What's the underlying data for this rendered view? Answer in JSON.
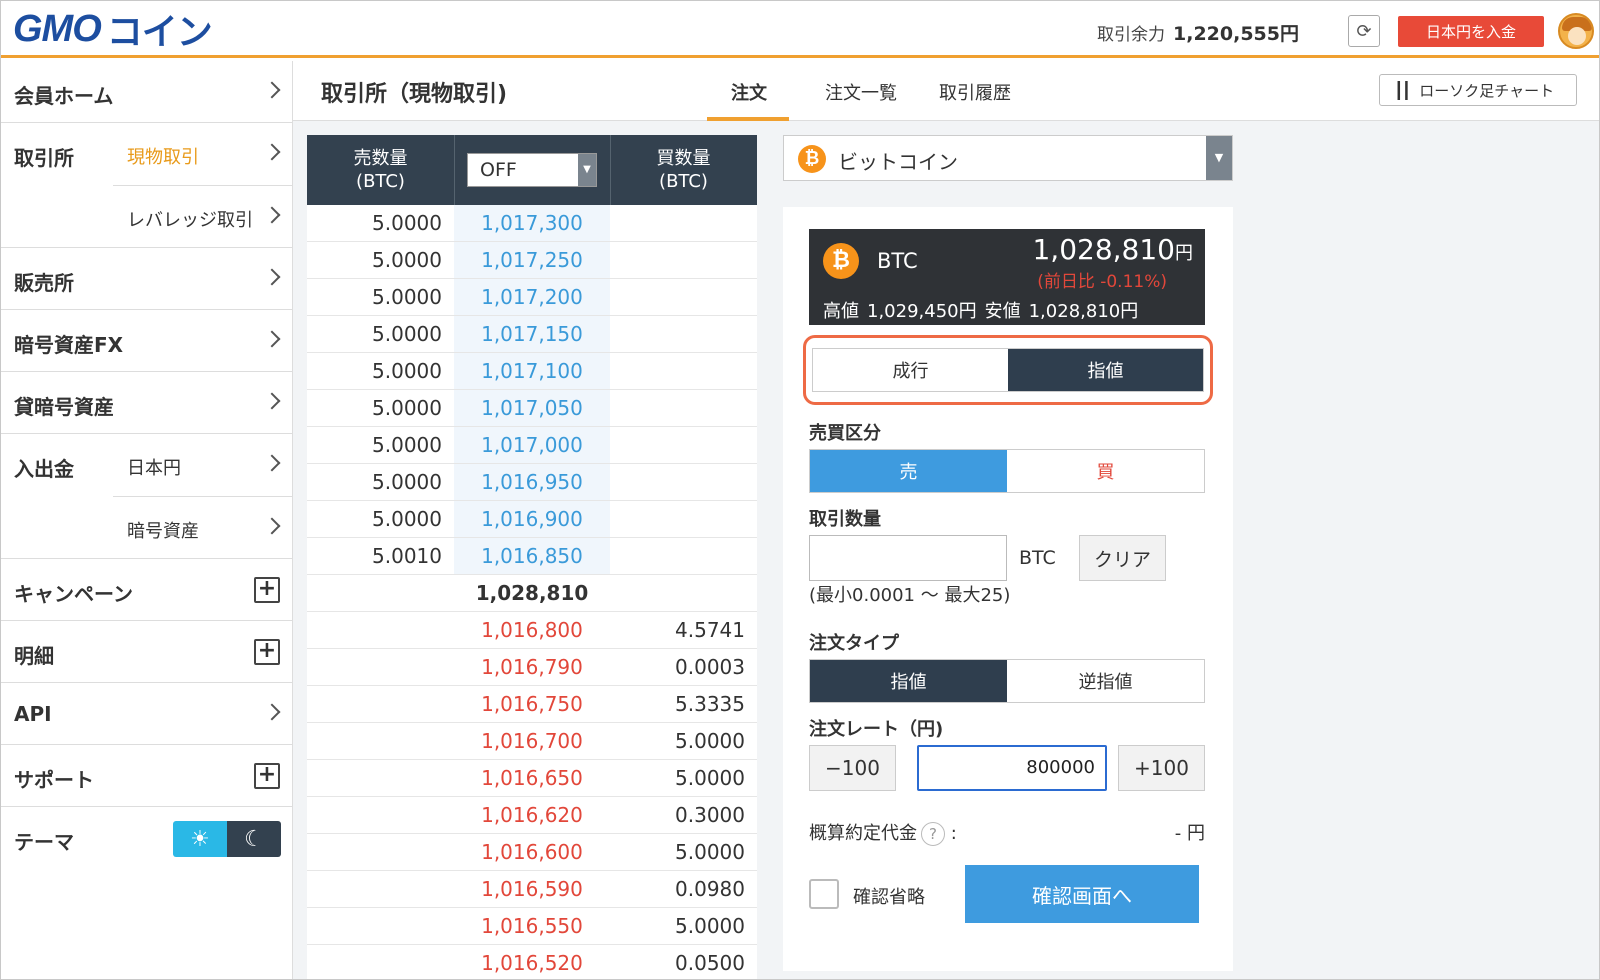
{
  "header": {
    "logo_text": "GMO",
    "logo_sub": "コイン",
    "balance_label": "取引余力",
    "balance_value": "1,220,555円",
    "refresh_icon": "refresh-icon",
    "deposit_button": "日本円を入金",
    "accent_color": "#f0a030",
    "brand_color": "#1d4ea0"
  },
  "sidebar": {
    "home": "会員ホーム",
    "exchange": "取引所",
    "exchange_spot": "現物取引",
    "exchange_leverage": "レバレッジ取引",
    "sales": "販売所",
    "fx": "暗号資産FX",
    "lending": "貸暗号資産",
    "deposit": "入出金",
    "deposit_jpy": "日本円",
    "deposit_crypto": "暗号資産",
    "campaign": "キャンペーン",
    "statement": "明細",
    "api": "API",
    "support": "サポート",
    "theme": "テーマ",
    "active_color": "#e89a1a"
  },
  "topbar": {
    "title": "取引所（現物取引)",
    "tabs": [
      "注文",
      "注文一覧",
      "取引履歴"
    ],
    "chart_button": "ローソク足チャート"
  },
  "orderbook": {
    "sell_header": "売数量",
    "sell_unit": "(BTC)",
    "buy_header": "買数量",
    "buy_unit": "(BTC)",
    "group_select": "OFF",
    "asks": [
      {
        "qty": "5.0000",
        "price": "1,017,300"
      },
      {
        "qty": "5.0000",
        "price": "1,017,250"
      },
      {
        "qty": "5.0000",
        "price": "1,017,200"
      },
      {
        "qty": "5.0000",
        "price": "1,017,150"
      },
      {
        "qty": "5.0000",
        "price": "1,017,100"
      },
      {
        "qty": "5.0000",
        "price": "1,017,050"
      },
      {
        "qty": "5.0000",
        "price": "1,017,000"
      },
      {
        "qty": "5.0000",
        "price": "1,016,950"
      },
      {
        "qty": "5.0000",
        "price": "1,016,900"
      },
      {
        "qty": "5.0010",
        "price": "1,016,850"
      }
    ],
    "last_price": "1,028,810",
    "bids": [
      {
        "price": "1,016,800",
        "qty": "4.5741"
      },
      {
        "price": "1,016,790",
        "qty": "0.0003"
      },
      {
        "price": "1,016,750",
        "qty": "5.3335"
      },
      {
        "price": "1,016,700",
        "qty": "5.0000"
      },
      {
        "price": "1,016,650",
        "qty": "5.0000"
      },
      {
        "price": "1,016,620",
        "qty": "0.3000"
      },
      {
        "price": "1,016,600",
        "qty": "5.0000"
      },
      {
        "price": "1,016,590",
        "qty": "0.0980"
      },
      {
        "price": "1,016,550",
        "qty": "5.0000"
      },
      {
        "price": "1,016,520",
        "qty": "0.0500"
      }
    ],
    "ask_color": "#3a9ad9",
    "bid_color": "#e2473a"
  },
  "coin_select": {
    "icon": "bitcoin-icon",
    "name": "ビットコイン"
  },
  "ticker": {
    "symbol": "BTC",
    "price": "1,028,810",
    "yen": "円",
    "change": "(前日比 -0.11%)",
    "high_label": "高値",
    "high_value": "1,029,450円",
    "low_label": "安値",
    "low_value": "1,028,810円"
  },
  "order_form": {
    "market": "成行",
    "limit": "指値",
    "side_label": "売買区分",
    "sell": "売",
    "buy": "買",
    "qty_label": "取引数量",
    "qty_value": "",
    "qty_unit": "BTC",
    "clear": "クリア",
    "qty_range": "(最小0.0001 〜 最大25)",
    "type_label": "注文タイプ",
    "type_limit": "指値",
    "type_stop": "逆指値",
    "rate_label": "注文レート（円)",
    "minus": "−100",
    "rate_value": "800000",
    "plus": "+100",
    "estimate_label": "概算約定代金",
    "estimate_help": "?",
    "estimate_colon": ":",
    "estimate_value": "- 円",
    "skip_confirm": "確認省略",
    "confirm_button": "確認画面へ",
    "highlight_color": "#ee6a45",
    "confirm_color": "#3e9bdf"
  }
}
